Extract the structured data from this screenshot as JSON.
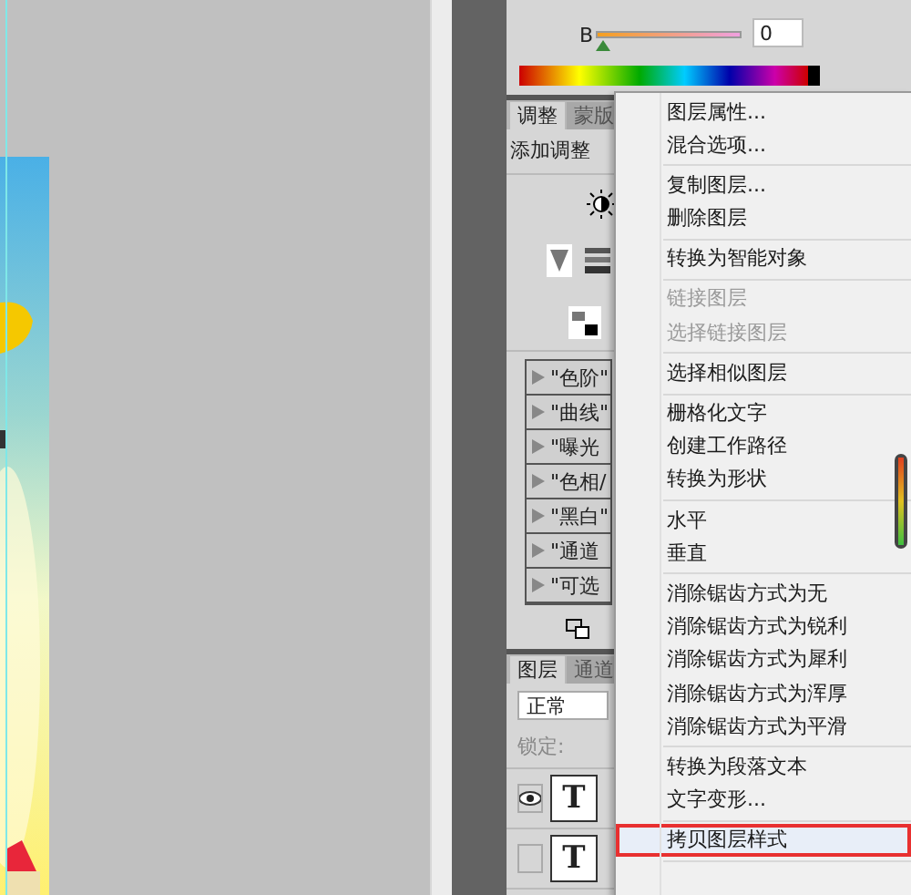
{
  "color_panel": {
    "channel": "B",
    "level": 0,
    "value": "0"
  },
  "adjustments_panel": {
    "tabs": [
      {
        "label": "调整",
        "selected": true
      },
      {
        "label": "蒙版",
        "selected": false
      }
    ],
    "title": "添加调整",
    "presets": [
      {
        "label": "\"色阶\""
      },
      {
        "label": "\"曲线\""
      },
      {
        "label": "\"曝光"
      },
      {
        "label": "\"色相/"
      },
      {
        "label": "\"黑白\""
      },
      {
        "label": "\"通道"
      },
      {
        "label": "\"可选"
      }
    ]
  },
  "layers_panel": {
    "tabs": [
      {
        "label": "图层",
        "selected": true
      },
      {
        "label": "通道",
        "selected": false
      }
    ],
    "blend_mode": "正常",
    "lock_label": "锁定:",
    "layers": [
      {
        "visible": true,
        "thumbnail_text": "T"
      },
      {
        "visible": false,
        "thumbnail_text": "T"
      }
    ]
  },
  "context_menu": {
    "sections": [
      {
        "items": [
          {
            "label": "图层属性...",
            "disabled": false,
            "highlighted": false
          },
          {
            "label": "混合选项...",
            "disabled": false,
            "highlighted": false
          }
        ]
      },
      {
        "items": [
          {
            "label": "复制图层...",
            "disabled": false,
            "highlighted": false
          },
          {
            "label": "删除图层",
            "disabled": false,
            "highlighted": false
          }
        ]
      },
      {
        "items": [
          {
            "label": "转换为智能对象",
            "disabled": false,
            "highlighted": false
          }
        ]
      },
      {
        "items": [
          {
            "label": "链接图层",
            "disabled": true,
            "highlighted": false
          },
          {
            "label": "选择链接图层",
            "disabled": true,
            "highlighted": false
          }
        ]
      },
      {
        "items": [
          {
            "label": "选择相似图层",
            "disabled": false,
            "highlighted": false
          }
        ]
      },
      {
        "items": [
          {
            "label": "栅格化文字",
            "disabled": false,
            "highlighted": false
          },
          {
            "label": "创建工作路径",
            "disabled": false,
            "highlighted": false
          },
          {
            "label": "转换为形状",
            "disabled": false,
            "highlighted": false
          }
        ]
      },
      {
        "items": [
          {
            "label": "水平",
            "disabled": false,
            "highlighted": false
          },
          {
            "label": "垂直",
            "disabled": false,
            "highlighted": false
          }
        ]
      },
      {
        "items": [
          {
            "label": "消除锯齿方式为无",
            "disabled": false,
            "highlighted": false
          },
          {
            "label": "消除锯齿方式为锐利",
            "disabled": false,
            "highlighted": false
          },
          {
            "label": "消除锯齿方式为犀利",
            "disabled": false,
            "highlighted": false
          },
          {
            "label": "消除锯齿方式为浑厚",
            "disabled": false,
            "highlighted": false
          },
          {
            "label": "消除锯齿方式为平滑",
            "disabled": false,
            "highlighted": false
          }
        ]
      },
      {
        "items": [
          {
            "label": "转换为段落文本",
            "disabled": false,
            "highlighted": false
          },
          {
            "label": "文字变形...",
            "disabled": false,
            "highlighted": false
          }
        ]
      },
      {
        "items": [
          {
            "label": "拷贝图层样式",
            "disabled": false,
            "highlighted": true
          }
        ]
      }
    ]
  }
}
